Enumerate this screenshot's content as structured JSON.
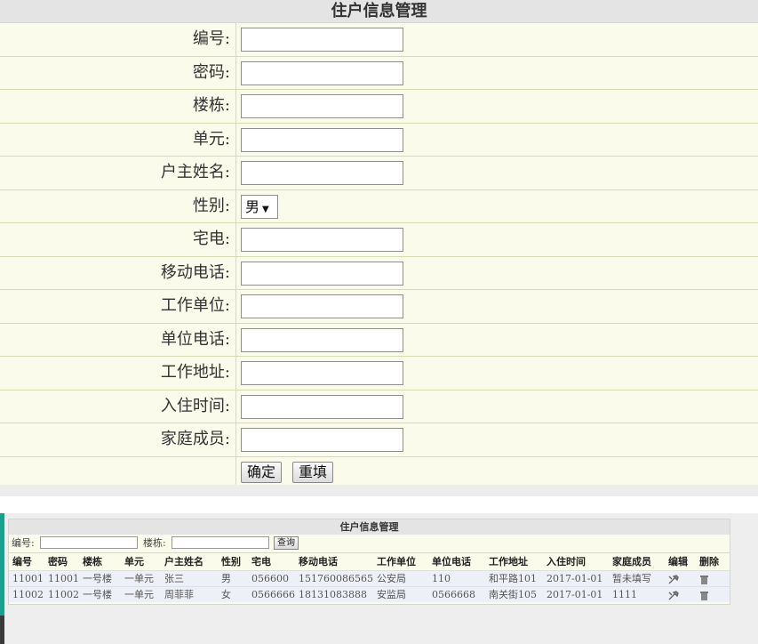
{
  "form": {
    "title": "住户信息管理",
    "fields": [
      {
        "label": "编号:",
        "value": ""
      },
      {
        "label": "密码:",
        "value": ""
      },
      {
        "label": "楼栋:",
        "value": ""
      },
      {
        "label": "单元:",
        "value": ""
      },
      {
        "label": "户主姓名:",
        "value": ""
      },
      {
        "label": "性别:",
        "value": "男"
      },
      {
        "label": "宅电:",
        "value": ""
      },
      {
        "label": "移动电话:",
        "value": ""
      },
      {
        "label": "工作单位:",
        "value": ""
      },
      {
        "label": "单位电话:",
        "value": ""
      },
      {
        "label": "工作地址:",
        "value": ""
      },
      {
        "label": "入住时间:",
        "value": ""
      },
      {
        "label": "家庭成员:",
        "value": ""
      }
    ],
    "gender_arrow": "▼",
    "confirm_label": "确定",
    "reset_label": "重填"
  },
  "list": {
    "title": "住户信息管理",
    "search": {
      "id_label": "编号:",
      "building_label": "楼栋:",
      "query_label": "查询"
    },
    "columns": [
      "编号",
      "密码",
      "楼栋",
      "单元",
      "户主姓名",
      "性别",
      "宅电",
      "移动电话",
      "工作单位",
      "单位电话",
      "工作地址",
      "入住时间",
      "家庭成员",
      "编辑",
      "删除"
    ],
    "rows": [
      [
        "11001",
        "11001",
        "一号楼",
        "一单元",
        "张三",
        "男",
        "056600",
        "151760086565",
        "公安局",
        "110",
        "和平路101",
        "2017-01-01",
        "暂未填写"
      ],
      [
        "11002",
        "11002",
        "一号楼",
        "一单元",
        "周菲菲",
        "女",
        "0566666",
        "18131083888",
        "安监局",
        "0566668",
        "南关街105",
        "2017-01-01",
        "1111"
      ]
    ],
    "edit_icon": "edit-icon",
    "delete_icon": "trash-icon"
  }
}
